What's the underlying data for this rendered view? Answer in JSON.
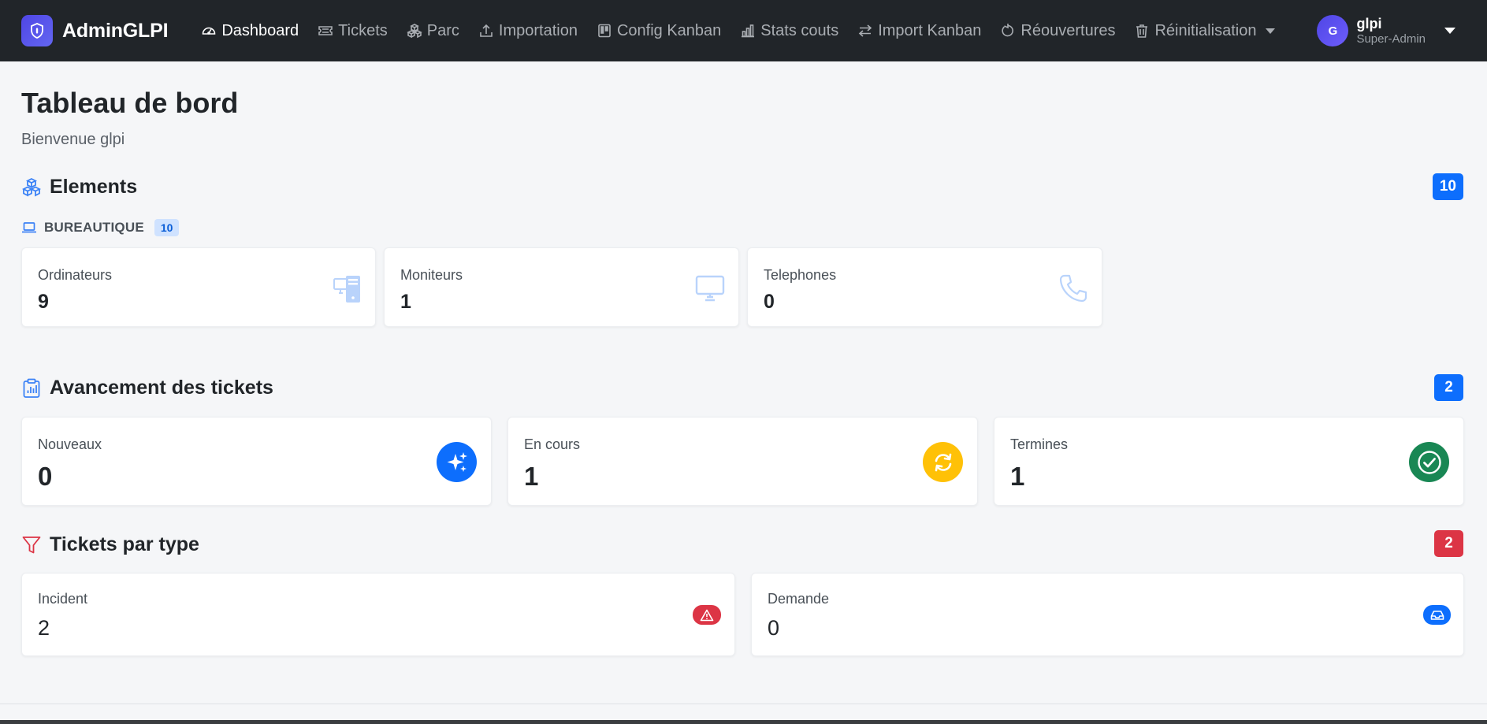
{
  "navbar": {
    "brand": "AdminGLPI",
    "items": [
      {
        "label": "Dashboard",
        "icon": "gauge-icon",
        "active": true
      },
      {
        "label": "Tickets",
        "icon": "ticket-icon"
      },
      {
        "label": "Parc",
        "icon": "boxes-icon"
      },
      {
        "label": "Importation",
        "icon": "upload-icon"
      },
      {
        "label": "Config Kanban",
        "icon": "kanban-icon"
      },
      {
        "label": "Stats couts",
        "icon": "bar-chart-icon"
      },
      {
        "label": "Import Kanban",
        "icon": "arrows-icon"
      },
      {
        "label": "Réouvertures",
        "icon": "rotate-icon"
      },
      {
        "label": "Réinitialisation",
        "icon": "trash-icon"
      }
    ],
    "user": {
      "initial": "G",
      "name": "glpi",
      "role": "Super-Admin"
    }
  },
  "page": {
    "title": "Tableau de bord",
    "subtitle": "Bienvenue glpi"
  },
  "elements": {
    "title": "Elements",
    "count": "10",
    "category": {
      "label": "BUREAUTIQUE",
      "count": "10"
    },
    "cards": [
      {
        "label": "Ordinateurs",
        "value": "9",
        "icon": "pc-display-icon"
      },
      {
        "label": "Moniteurs",
        "value": "1",
        "icon": "monitor-icon"
      },
      {
        "label": "Telephones",
        "value": "0",
        "icon": "telephone-icon"
      }
    ]
  },
  "progress": {
    "title": "Avancement des tickets",
    "count": "2",
    "cards": [
      {
        "label": "Nouveaux",
        "value": "0",
        "icon": "stars-icon",
        "color": "#0d6efd"
      },
      {
        "label": "En cours",
        "value": "1",
        "icon": "sync-icon",
        "color": "#ffc107"
      },
      {
        "label": "Termines",
        "value": "1",
        "icon": "check-circle-icon",
        "color": "#198754"
      }
    ]
  },
  "types": {
    "title": "Tickets par type",
    "count": "2",
    "cards": [
      {
        "label": "Incident",
        "value": "2",
        "icon": "warning-icon",
        "color": "#dc3545"
      },
      {
        "label": "Demande",
        "value": "0",
        "icon": "inbox-icon",
        "color": "#0d6efd"
      }
    ]
  },
  "colors": {
    "navbar": "#212529",
    "primary": "#0d6efd",
    "danger": "#dc3545",
    "warning": "#ffc107",
    "success": "#198754",
    "background": "#f5f6f8"
  }
}
